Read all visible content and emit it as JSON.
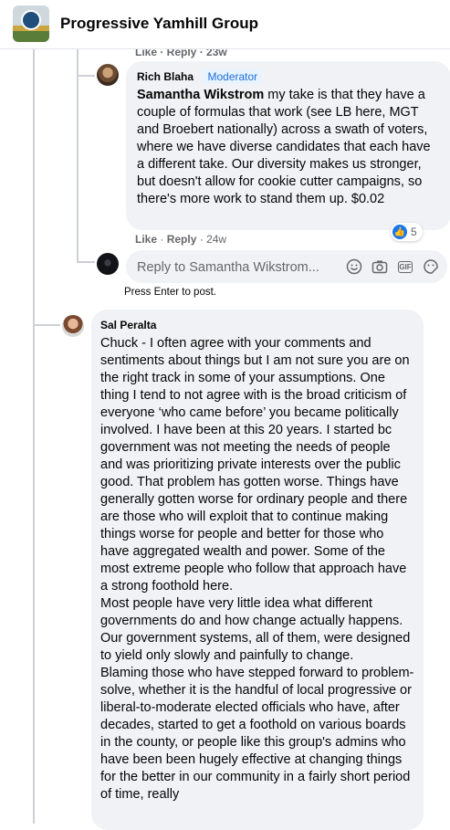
{
  "header": {
    "group_name": "Progressive Yamhill Group"
  },
  "previous_meta": "Like · Reply · 23w",
  "rich_comment": {
    "author": "Rich Blaha",
    "badge": "Moderator",
    "mention": "Samantha Wikstrom",
    "text": " my take is that they have a couple of formulas that work (see LB here, MGT and Broebert nationally) across a swath of voters, where we have diverse candidates that each have a different take. Our diversity makes us stronger, but doesn't allow for cookie cutter campaigns, so there's more work to stand them up. $0.02",
    "reaction_count": "5",
    "like_label": "Like",
    "reply_label": "Reply",
    "time": "24w"
  },
  "reply_box": {
    "placeholder": "Reply to Samantha Wikstrom...",
    "icons": [
      "emoji-icon",
      "camera-icon",
      "gif-icon",
      "sticker-icon"
    ]
  },
  "hint": "Press Enter to post.",
  "sal_comment": {
    "author": "Sal Peralta",
    "paragraphs": [
      "Chuck - I often agree with your comments and sentiments about things but I am not sure you are on the right track in some of your assumptions. One thing I tend to not agree with is the broad criticism of everyone ‘who came before’ you became politically involved. I have been at this 20 years. I started bc government was not meeting the needs of people and was prioritizing private interests over the public good. That problem has gotten worse. Things have generally gotten worse for ordinary people and there are those who will exploit that to continue making things worse for people and better for those who have aggregated wealth and power. Some of the most extreme people who follow that approach have a strong foothold here.",
      "Most people have very little idea what different governments do and how change actually happens. Our government systems, all of them, were designed to yield only slowly and painfully to change.",
      "Blaming those who have stepped forward to problem-solve, whether it is the handful of local progressive or liberal-to-moderate elected officials who have, after decades, started to get a foothold on various boards in the county, or people like this group's admins who have been been hugely effective at changing things for the better in our community in a fairly short period of time, really"
    ]
  },
  "colors": {
    "link_blue": "#216fdb",
    "bubble_bg": "#f0f2f5",
    "like_blue": "#1877f2"
  }
}
